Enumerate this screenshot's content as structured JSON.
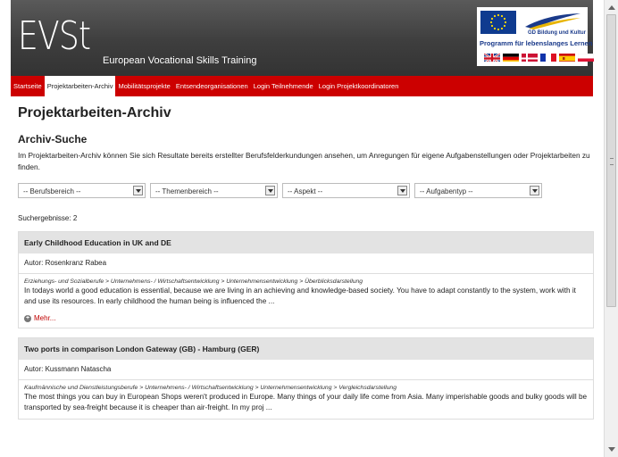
{
  "header": {
    "logo_text": "EVSt",
    "logo_subtitle": "European Vocational Skills Training",
    "eu_small_text": "GD Bildung und Kultur",
    "eu_program_text": "Programm für lebenslanges Lernen",
    "flags": [
      "uk-flag-icon",
      "germany-flag-icon",
      "denmark-flag-icon",
      "france-flag-icon",
      "spain-flag-icon",
      "poland-flag-icon"
    ]
  },
  "nav": {
    "items": [
      {
        "label": "Startseite",
        "active": false
      },
      {
        "label": "Projektarbeiten-Archiv",
        "active": true
      },
      {
        "label": "Mobilitätsprojekte",
        "active": false
      },
      {
        "label": "Entsendeorganisationen",
        "active": false
      },
      {
        "label": "Login Teilnehmende",
        "active": false
      },
      {
        "label": "Login Projektkoordinatoren",
        "active": false
      }
    ]
  },
  "main": {
    "title": "Projektarbeiten-Archiv",
    "search_title": "Archiv-Suche",
    "intro": "Im Projektarbeiten-Archiv können Sie sich Resultate bereits erstellter Berufsfelderkundungen ansehen, um Anregungen für eigene Aufgabenstellungen oder Projektarbeiten zu finden.",
    "filters": [
      {
        "label": "-- Berufsbereich --"
      },
      {
        "label": "-- Themenbereich --"
      },
      {
        "label": "-- Aspekt --"
      },
      {
        "label": "-- Aufgabentyp --"
      }
    ],
    "results_label": "Suchergebnisse: 2",
    "results": [
      {
        "title": "Early Childhood Education in UK and DE",
        "author": "Autor: Rosenkranz Rabea",
        "category": "Erziehungs- und Sozialberufe > Unternehmens- / Wirtschaftsentwicklung > Unternehmensentwicklung > Überblicksdarstellung",
        "description": "In todays world a good education is essential, because we are living in an achieving and knowledge-based society. You have to adapt constantly to the system, work with it and use its resources. In early childhood the human being is influenced the ...",
        "more_label": "Mehr..."
      },
      {
        "title": "Two ports in comparison London Gateway (GB) - Hamburg (GER)",
        "author": "Autor: Kussmann Natascha",
        "category": "Kaufmännische und Dienstleistungsberufe > Unternehmens- / Wirtschaftsentwicklung > Unternehmensentwicklung > Vergleichsdarstellung",
        "description": "The most things you can buy in European Shops weren't produced in Europe. Many things of your daily life come from Asia. Many imperishable goods and bulky goods will be transported by sea-freight because it is cheaper than air-freight. In my proj ..."
      }
    ]
  },
  "colors": {
    "nav_red": "#cc0000",
    "header_gray": "#444444",
    "link_red": "#c00000",
    "card_head": "#e3e3e3"
  }
}
